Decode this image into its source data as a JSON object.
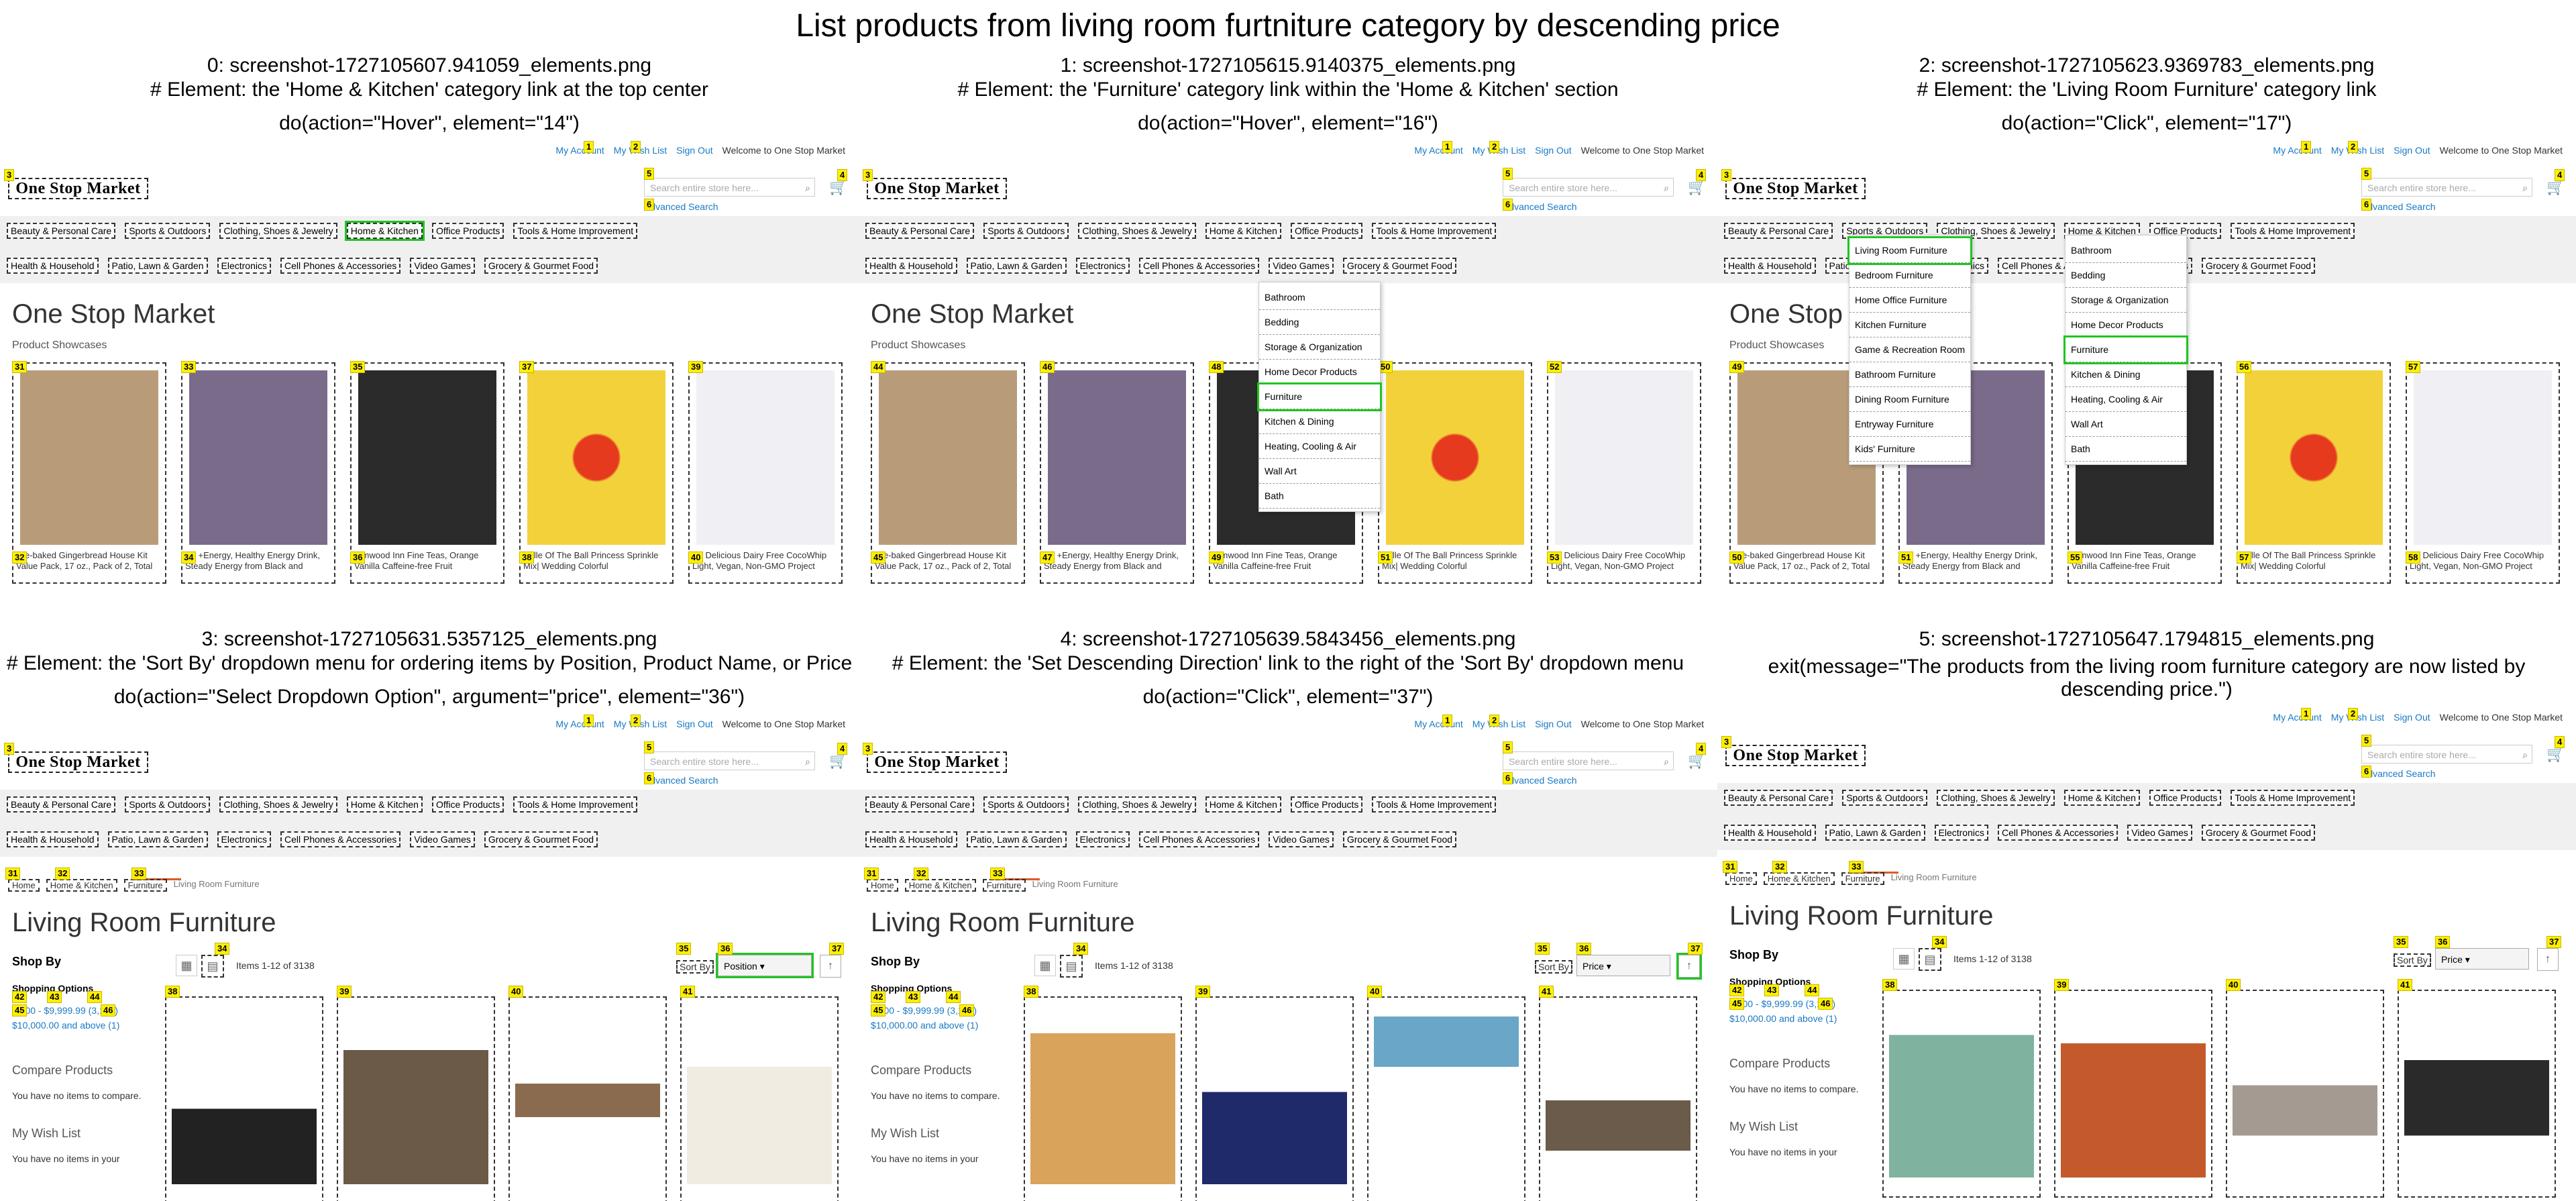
{
  "title": "List products from living room furtniture category by descending price",
  "store": {
    "my_account": "My Account",
    "wish_list": "My Wish List",
    "sign_in": "Sign Out",
    "welcome": "Welcome to One Stop Market",
    "logo": "One Stop Market",
    "search_placeholder": "Search entire store here...",
    "advanced_search": "Advanced Search",
    "nav_row1": [
      "Beauty & Personal Care",
      "Sports & Outdoors",
      "Clothing, Shoes & Jewelry",
      "Home & Kitchen",
      "Office Products",
      "Tools & Home Improvement"
    ],
    "nav_row2": [
      "Health & Household",
      "Patio, Lawn & Garden",
      "Electronics",
      "Cell Phones & Accessories",
      "Video Games",
      "Grocery & Gourmet Food"
    ],
    "home_heading": "One Stop Market",
    "showcases": "Product Showcases",
    "products": [
      "Pre-baked Gingerbread House Kit Value Pack, 17 oz., Pack of 2, Total",
      "V8 +Energy, Healthy Energy Drink, Steady Energy from Black and",
      "Elmwood Inn Fine Teas, Orange Vanilla Caffeine-free Fruit",
      "Belle Of The Ball Princess Sprinkle Mix| Wedding Colorful",
      "So Delicious Dairy Free CocoWhip Light, Vegan, Non-GMO Project"
    ],
    "home_kitchen_submenu": [
      "Bathroom",
      "Bedding",
      "Storage & Organization",
      "Home Decor Products",
      "Furniture",
      "Kitchen & Dining",
      "Heating, Cooling & Air",
      "Wall Art",
      "Bath"
    ],
    "furniture_submenu": [
      "Living Room Furniture",
      "Bedroom Furniture",
      "Home Office Furniture",
      "Kitchen Furniture",
      "Game & Recreation Room",
      "Bathroom Furniture",
      "Dining Room Furniture",
      "Entryway Furniture",
      "Kids' Furniture"
    ],
    "breadcrumb": [
      "Home",
      "Home & Kitchen",
      "Furniture",
      "Living Room Furniture"
    ],
    "category_heading": "Living Room Furniture",
    "shop_by": "Shop By",
    "shopping_options": "Shopping Options",
    "price_options": [
      "$0.00 - $9,999.99 (3,137)",
      "$10,000.00 and above (1)"
    ],
    "compare_products": "Compare Products",
    "no_items_compare": "You have no items to compare.",
    "my_wish_list": "My Wish List",
    "no_items_wish": "You have no items in your",
    "items_count": "Items 1-12 of 3138",
    "sort_by": "Sort By",
    "sort_position": "Position",
    "sort_price": "Price"
  },
  "steps": [
    {
      "file": "0: screenshot-1727105607.941059_elements.png",
      "element": "# Element: the 'Home & Kitchen' category link at the top center",
      "action": "do(action=\"Hover\", element=\"14\")",
      "view": "home"
    },
    {
      "file": "1: screenshot-1727105615.9140375_elements.png",
      "element": "# Element: the 'Furniture' category link within the 'Home & Kitchen' section",
      "action": "do(action=\"Hover\", element=\"16\")",
      "view": "home-menu1"
    },
    {
      "file": "2: screenshot-1727105623.9369783_elements.png",
      "element": "# Element: the 'Living Room Furniture' category link",
      "action": "do(action=\"Click\", element=\"17\")",
      "view": "home-menu2"
    },
    {
      "file": "3: screenshot-1727105631.5357125_elements.png",
      "element": "# Element: the 'Sort By' dropdown menu for ordering items by Position, Product Name, or Price",
      "action": "do(action=\"Select Dropdown Option\", argument=\"price\", element=\"36\")",
      "view": "category-position"
    },
    {
      "file": "4: screenshot-1727105639.5843456_elements.png",
      "element": "# Element: the 'Set Descending Direction' link to the right of the 'Sort By' dropdown menu",
      "action": "do(action=\"Click\", element=\"37\")",
      "view": "category-price"
    },
    {
      "file": "5: screenshot-1727105647.1794815_elements.png",
      "element": "",
      "action": "exit(message=\"The products from the living room furniture category are now listed by descending price.\")",
      "view": "category-desc"
    }
  ],
  "colors": {
    "badge": "#ffef00",
    "link": "#1979c3",
    "highlight": "#21c421"
  }
}
